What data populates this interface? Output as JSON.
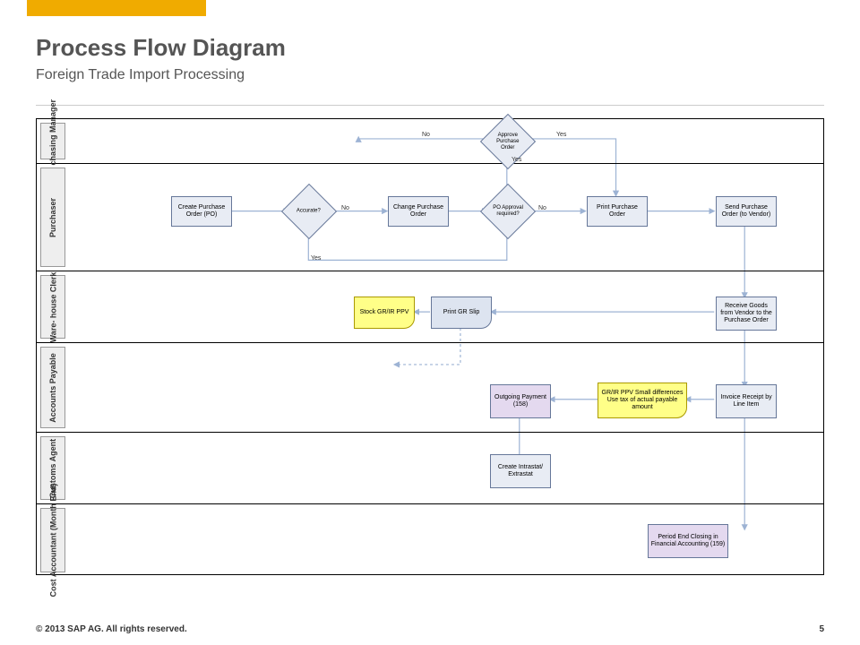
{
  "header": {
    "title": "Process Flow Diagram",
    "subtitle": "Foreign Trade Import Processing"
  },
  "lanes": {
    "l0": "Pur-\nchasing\nManager",
    "l1": "Purchaser",
    "l2": "Ware-\nhouse\nClerk",
    "l3": "Accounts\nPayable",
    "l4": "Customs\nAgent",
    "l5": "Cost\nAccountant\n(Month\nEnd)"
  },
  "nodes": {
    "approve": "Approve Purchase Order",
    "createPO": "Create Purchase Order (PO)",
    "accurate": "Accurate?",
    "changePO": "Change Purchase Order",
    "poApproval": "PO Approval required?",
    "printPO": "Print Purchase Order",
    "sendPO": "Send Purchase Order (to Vendor)",
    "stockPPV": "Stock GR/IR PPV",
    "printGR": "Print GR Slip",
    "receiveGoods": "Receive Goods from Vendor to the Purchase Order",
    "outgoing": "Outgoing Payment (158)",
    "grirPPV": "GR/IR PPV Small differences Use tax of actual payable amount",
    "invoiceRcpt": "Invoice Receipt by Line Item",
    "intrastat": "Create Intrastat/ Extrastat",
    "periodEnd": "Period End Closing in Financial Accounting (159)"
  },
  "labels": {
    "yes": "Yes",
    "no": "No"
  },
  "footer": {
    "copyright": "© 2013 SAP AG. All rights reserved.",
    "page": "5"
  }
}
